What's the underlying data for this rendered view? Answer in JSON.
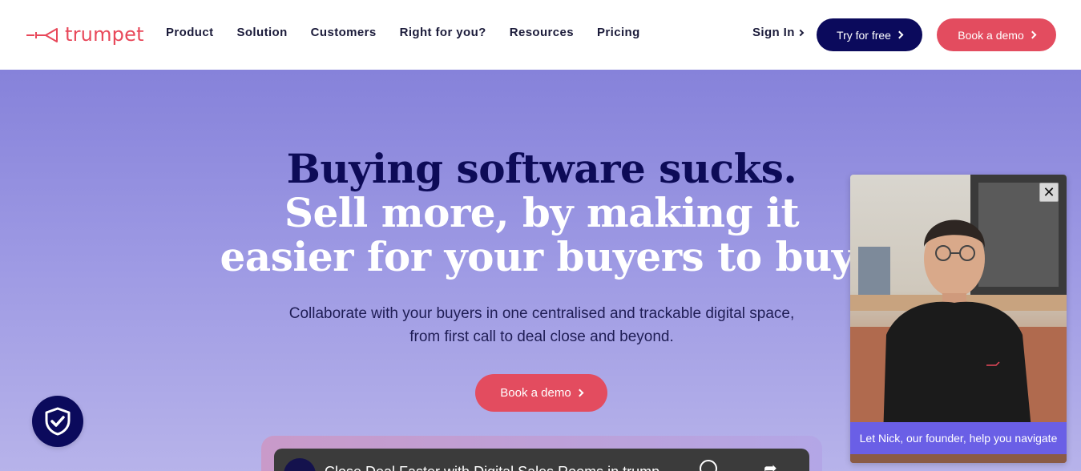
{
  "brand": {
    "name": "trumpet",
    "accent": "#e8485a",
    "navy": "#0b0a5c",
    "hero_gradient": [
      "#8682da",
      "#b7b3ea"
    ]
  },
  "nav": {
    "links": [
      "Product",
      "Solution",
      "Customers",
      "Right for you?",
      "Resources",
      "Pricing"
    ],
    "signin_label": "Sign In",
    "try_free_label": "Try for free",
    "book_demo_label": "Book a demo"
  },
  "hero": {
    "headline_line1": "Buying software sucks.",
    "headline_line2": "Sell more, by making it",
    "headline_line3": "easier for your buyers to buy.",
    "subtext_line1": "Collaborate with your buyers in one centralised and trackable digital space,",
    "subtext_line2": "from first call to deal close and beyond.",
    "cta_label": "Book a demo"
  },
  "video": {
    "title": "Close Deal Faster with Digital Sales Rooms in trump...",
    "icons": [
      "clock-icon",
      "share-icon"
    ]
  },
  "founder_widget": {
    "caption": "Let Nick, our founder, help you navigate",
    "close_label": "✕"
  },
  "security_badge": {
    "icon": "shield-check-icon"
  }
}
